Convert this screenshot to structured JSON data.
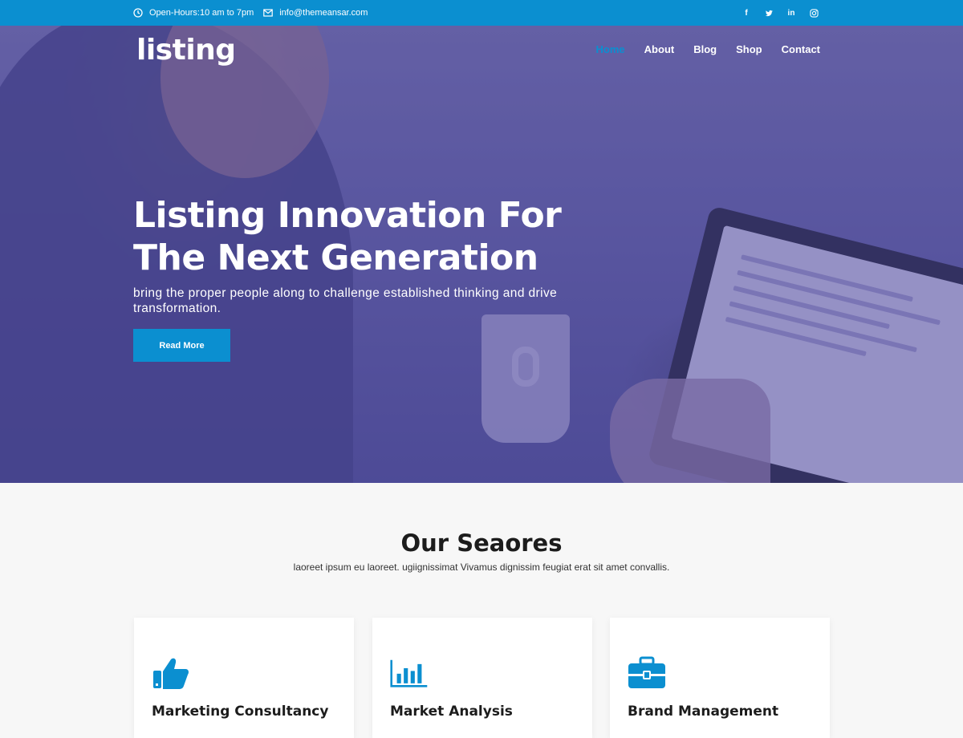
{
  "topbar": {
    "hours": "Open-Hours:10 am to 7pm",
    "email": "info@themeansar.com",
    "social": [
      {
        "icon": "facebook-icon",
        "glyph": "f"
      },
      {
        "icon": "twitter-icon",
        "glyph": "t"
      },
      {
        "icon": "linkedin-icon",
        "glyph": "in"
      },
      {
        "icon": "instagram-icon",
        "glyph": "◎"
      }
    ]
  },
  "header": {
    "logo": "listing",
    "nav": [
      "Home",
      "About",
      "Blog",
      "Shop",
      "Contact"
    ],
    "active_nav": "Home"
  },
  "hero": {
    "title": "Listing Innovation For\nThe Next Generation",
    "subtitle": "bring the proper people along to challenge established thinking and drive transformation.",
    "button": "Read More"
  },
  "services": {
    "title": "Our Seaores",
    "description": "laoreet ipsum eu laoreet. ugiignissimat Vivamus dignissim feugiat erat sit amet convallis.",
    "cards": [
      {
        "label": "Marketing Consultancy",
        "icon": "thumbs-up-icon"
      },
      {
        "label": "Market Analysis",
        "icon": "bar-chart-icon"
      },
      {
        "label": "Brand Management",
        "icon": "briefcase-icon"
      }
    ]
  },
  "colors": {
    "accent": "#0b8fd0",
    "hero_overlay": "#524ca0"
  }
}
